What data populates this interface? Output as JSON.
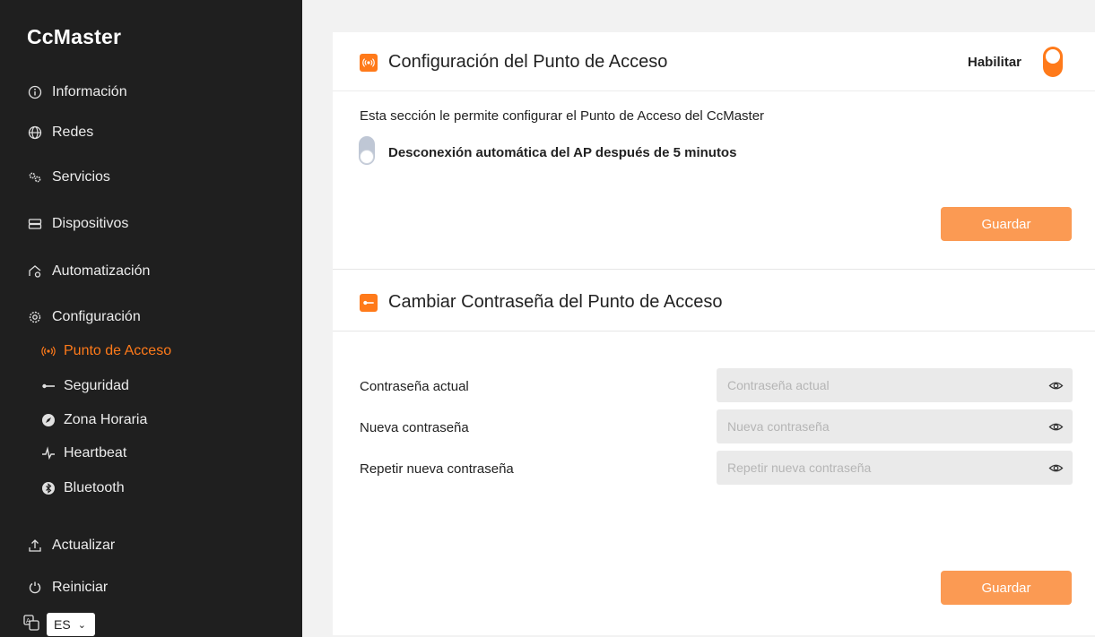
{
  "sidebar": {
    "brand": "CcMaster",
    "items": [
      {
        "label": "Información",
        "icon": "info-icon"
      },
      {
        "label": "Redes",
        "icon": "globe-icon"
      },
      {
        "label": "Servicios",
        "icon": "gears-icon"
      },
      {
        "label": "Dispositivos",
        "icon": "server-icon"
      },
      {
        "label": "Automatización",
        "icon": "automation-icon"
      },
      {
        "label": "Configuración",
        "icon": "settings-icon"
      }
    ],
    "sub_items": [
      {
        "label": "Punto de Acceso",
        "icon": "broadcast-icon",
        "active": true
      },
      {
        "label": "Seguridad",
        "icon": "key-icon"
      },
      {
        "label": "Zona Horaria",
        "icon": "compass-icon"
      },
      {
        "label": "Heartbeat",
        "icon": "pulse-icon"
      },
      {
        "label": "Bluetooth",
        "icon": "bluetooth-icon"
      }
    ],
    "bottom_items": [
      {
        "label": "Actualizar",
        "icon": "upload-icon"
      },
      {
        "label": "Reiniciar",
        "icon": "restart-icon"
      }
    ],
    "language": {
      "selected": "ES",
      "icon": "translate-icon"
    }
  },
  "ap_section": {
    "title": "Configuración del Punto de Acceso",
    "enable_label": "Habilitar",
    "enabled": true,
    "description": "Esta sección le permite configurar el Punto de Acceso del CcMaster",
    "auto_disconnect_label": "Desconexión automática del AP después de 5 minutos",
    "auto_disconnect_enabled": false,
    "save_label": "Guardar"
  },
  "password_section": {
    "title": "Cambiar Contraseña del Punto de Acceso",
    "fields": [
      {
        "label": "Contraseña actual",
        "placeholder": "Contraseña actual"
      },
      {
        "label": "Nueva contraseña",
        "placeholder": "Nueva contraseña"
      },
      {
        "label": "Repetir nueva contraseña",
        "placeholder": "Repetir nueva contraseña"
      }
    ],
    "save_label": "Guardar"
  },
  "colors": {
    "accent": "#ff7a1a",
    "button": "#fb9a53",
    "sidebar_bg": "#1f1f1f"
  }
}
